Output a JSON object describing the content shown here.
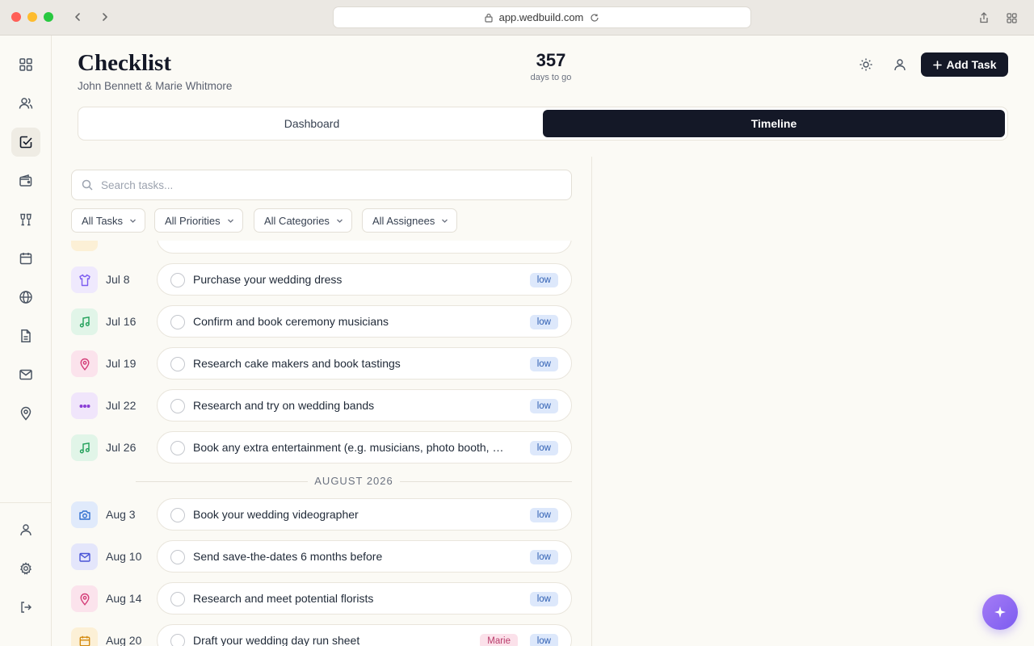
{
  "browser": {
    "url": "app.wedbuild.com"
  },
  "header": {
    "title": "Checklist",
    "couple": "John Bennett & Marie Whitmore",
    "countdown_value": "357",
    "countdown_label": "days to go",
    "add_task_label": "Add Task"
  },
  "tabs": {
    "dashboard": "Dashboard",
    "timeline": "Timeline",
    "active": "Timeline"
  },
  "search": {
    "placeholder": "Search tasks..."
  },
  "filters": {
    "tasks": "All Tasks",
    "priorities": "All Priorities",
    "categories": "All Categories",
    "assignees": "All Assignees"
  },
  "month_separator": "AUGUST 2026",
  "tasks": [
    {
      "date": "Jul 8",
      "title": "Purchase your wedding dress",
      "priority": "low",
      "icon": "shirt-icon",
      "color": "#7c5cf0",
      "bg": "#efe9fd"
    },
    {
      "date": "Jul 16",
      "title": "Confirm and book ceremony musicians",
      "priority": "low",
      "icon": "music-icon",
      "color": "#22a05a",
      "bg": "#e1f5e8"
    },
    {
      "date": "Jul 19",
      "title": "Research cake makers and book tastings",
      "priority": "low",
      "icon": "map-pin-icon",
      "color": "#d43d78",
      "bg": "#fbe3ec"
    },
    {
      "date": "Jul 22",
      "title": "Research and try on wedding bands",
      "priority": "low",
      "icon": "more-icon",
      "color": "#8b3fd6",
      "bg": "#f0e5fb"
    },
    {
      "date": "Jul 26",
      "title": "Book any extra entertainment (e.g. musicians, photo booth, magician)",
      "priority": "low",
      "icon": "music-icon",
      "color": "#22a05a",
      "bg": "#e1f5e8"
    },
    {
      "date": "Aug 3",
      "title": "Book your wedding videographer",
      "priority": "low",
      "icon": "camera-icon",
      "color": "#2f6fd0",
      "bg": "#e0eafb"
    },
    {
      "date": "Aug 10",
      "title": "Send save-the-dates 6 months before",
      "priority": "low",
      "icon": "mail-icon",
      "color": "#4954d6",
      "bg": "#e4e6fb"
    },
    {
      "date": "Aug 14",
      "title": "Research and meet potential florists",
      "priority": "low",
      "icon": "map-pin-icon",
      "color": "#d43d78",
      "bg": "#fbe3ec"
    },
    {
      "date": "Aug 20",
      "title": "Draft your wedding day run sheet",
      "priority": "low",
      "assignee": "Marie",
      "icon": "calendar-icon",
      "color": "#d48a0f",
      "bg": "#fcf0d6"
    }
  ]
}
